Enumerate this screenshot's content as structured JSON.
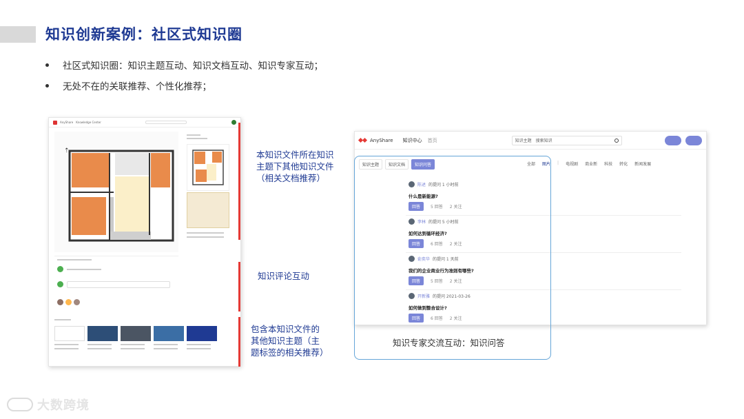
{
  "slide": {
    "title": "知识创新案例：社区式知识圈",
    "bullets": [
      "社区式知识圈：知识主题互动、知识文档互动、知识专家互动；",
      "无处不在的关联推荐、个性化推荐；"
    ]
  },
  "left_screenshot": {
    "brand": "AnyShare",
    "nav_label": "Knowledge Center"
  },
  "annotations": {
    "related_docs": [
      "本知识文件所在知识",
      "主题下其他知识文件",
      "（相关文档推荐）"
    ],
    "comments": "知识评论互动",
    "related_topics": [
      "包含本知识文件的",
      "其他知识主题（主",
      "题标签的相关推荐）"
    ]
  },
  "right_screenshot": {
    "brand": "AnyShare",
    "nav": [
      "知识中心",
      "首页"
    ],
    "search_scope": "知识主题",
    "search_placeholder": "搜索知识",
    "tabs": [
      "知识主题",
      "知识文档",
      "知识问答"
    ],
    "filters": [
      "全部",
      "图片",
      "电视剧",
      "商业新",
      "科技",
      "转化",
      "新闻发展"
    ],
    "questions": [
      {
        "user": "陈述",
        "meta": "的提问 1 小时前",
        "question": "什么是新能源?",
        "answer_label": "回答",
        "answers": "5 回答",
        "follows": "2 关注"
      },
      {
        "user": "李林",
        "meta": "的提问 5 小时前",
        "question": "如何达到循环经济?",
        "answer_label": "回答",
        "answers": "6 回答",
        "follows": "2 关注"
      },
      {
        "user": "俞奕华",
        "meta": "的提问 1 天前",
        "question": "我们的企业商业行为准则有哪些?",
        "answer_label": "回答",
        "answers": "5 回答",
        "follows": "2 关注"
      },
      {
        "user": "开新雅",
        "meta": "的提问 2021-03-26",
        "question": "如何做到整合设计?",
        "answer_label": "回答",
        "answers": "6 回答",
        "follows": "2 关注"
      }
    ],
    "caption": "知识专家交流互动：知识问答"
  },
  "watermark": {
    "text": "大数跨境"
  }
}
